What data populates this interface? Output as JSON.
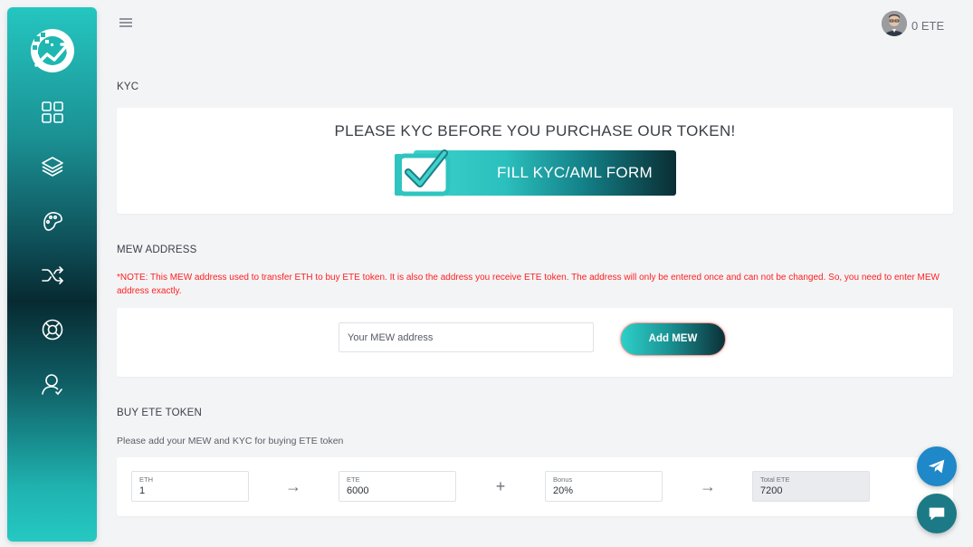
{
  "sidebar": {
    "icons": [
      "dashboard-icon",
      "layers-icon",
      "palette-icon",
      "shuffle-icon",
      "lifebuoy-icon",
      "user-icon"
    ]
  },
  "header": {
    "balance": "0 ETE"
  },
  "kyc": {
    "section_title": "KYC",
    "heading": "PLEASE KYC BEFORE YOU PURCHASE OUR TOKEN!",
    "button_label": "FILL KYC/AML FORM"
  },
  "mew": {
    "section_title": "MEW ADDRESS",
    "note": "*NOTE: This MEW address used to transfer ETH to buy ETE token. It is also the address you receive ETE token. The address will only be entered once and can not be changed. So, you need to enter MEW address exactly.",
    "input_placeholder": "Your MEW address",
    "input_value": "",
    "button_label": "Add MEW"
  },
  "buy": {
    "section_title": "BUY ETE TOKEN",
    "subtext": "Please add your MEW and KYC for buying ETE token",
    "fields": [
      {
        "label": "ETH",
        "value": "1"
      },
      {
        "label": "ETE",
        "value": "6000"
      },
      {
        "label": "Bonus",
        "value": "20%"
      },
      {
        "label": "Total ETE",
        "value": "7200"
      }
    ],
    "operators": [
      "→",
      "+",
      "→"
    ]
  },
  "colors": {
    "accent": "#26c8c2",
    "dark": "#0a2e34",
    "note_red": "#ff2020",
    "telegram": "#1e88c8"
  },
  "floating": {
    "telegram_icon": "telegram-icon",
    "chat_icon": "chat-icon"
  }
}
